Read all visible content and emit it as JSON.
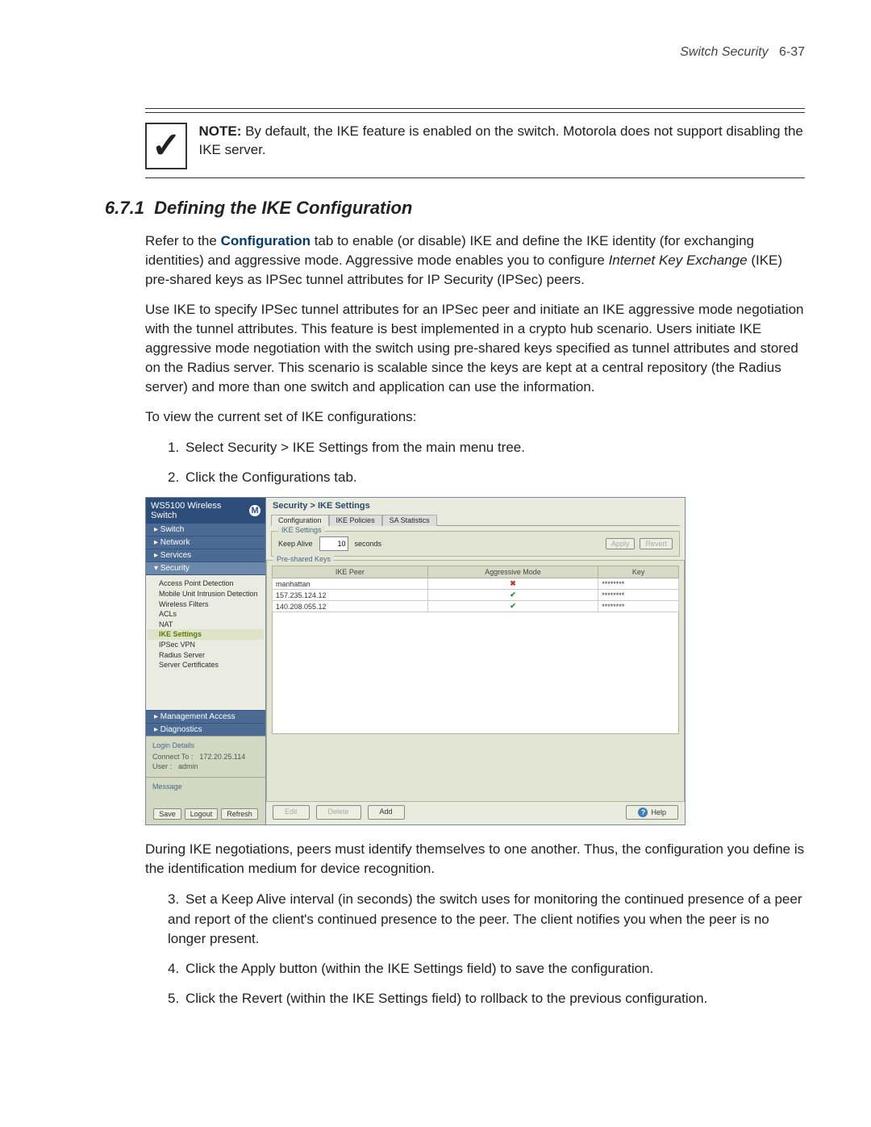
{
  "header": {
    "section": "Switch Security",
    "page": "6-37"
  },
  "note": {
    "label": "NOTE:",
    "text": "By default, the IKE feature is enabled on the switch. Motorola does not support disabling the IKE server."
  },
  "section": {
    "number": "6.7.1",
    "title": "Defining the IKE Configuration"
  },
  "para1_pre": "Refer to the ",
  "para1_bold": "Configuration",
  "para1_mid": " tab to enable (or disable) IKE and define the IKE identity (for exchanging identities) and aggressive mode. Aggressive mode enables you to configure ",
  "para1_italic": "Internet Key Exchange",
  "para1_end": " (IKE) pre-shared keys as IPSec tunnel attributes for IP Security (IPSec) peers.",
  "para2": "Use IKE to specify IPSec tunnel attributes for an IPSec peer and initiate an IKE aggressive mode negotiation with the tunnel attributes. This feature is best implemented in a crypto hub scenario. Users initiate IKE aggressive mode negotiation with the switch using pre-shared keys specified as tunnel attributes and stored on the Radius server. This scenario is scalable since the keys are kept at a central repository (the Radius server) and more than one switch and application can use the information.",
  "para3": "To view the current set of IKE configurations:",
  "step1_pre": "Select ",
  "step1_b1": "Security",
  "step1_gt": " > ",
  "step1_b2": "IKE Settings",
  "step1_end": " from the main menu tree.",
  "step2_pre": "Click the ",
  "step2_b": "Configurations",
  "step2_end": " tab.",
  "para4": "During IKE negotiations, peers must identify themselves to one another. Thus, the configuration you define is the identification medium for device recognition.",
  "step3_pre": "Set a ",
  "step3_b": "Keep Alive",
  "step3_end": " interval (in seconds) the switch uses for monitoring the continued presence of a peer and report of the client's continued presence to the peer. The client notifies you when the peer is no longer present.",
  "step4_pre": "Click the ",
  "step4_b": "Apply",
  "step4_end": " button (within the IKE Settings field) to save the configuration.",
  "step5_pre": "Click the ",
  "step5_b": "Revert",
  "step5_end": " (within the IKE Settings field) to rollback to the previous configuration.",
  "ui": {
    "title": "WS5100 Wireless Switch",
    "nav": {
      "switch": "▸ Switch",
      "network": "▸ Network",
      "services": "▸ Services",
      "security": "▾ Security",
      "ma": "▸ Management Access",
      "diag": "▸ Diagnostics"
    },
    "tree": {
      "apd": "Access Point Detection",
      "muid": "Mobile Unit Intrusion Detection",
      "wf": "Wireless Filters",
      "acl": "ACLs",
      "nat": "NAT",
      "ike": "IKE Settings",
      "ipsec": "IPSec VPN",
      "radius": "Radius Server",
      "cert": "Server Certificates"
    },
    "login": {
      "label": "Login Details",
      "connect_lbl": "Connect To :",
      "connect_val": "172.20.25.114",
      "user_lbl": "User :",
      "user_val": "admin"
    },
    "message_label": "Message",
    "bottom_btns": {
      "save": "Save",
      "logout": "Logout",
      "refresh": "Refresh"
    },
    "breadcrumb": "Security > IKE Settings",
    "tabs": {
      "t1": "Configuration",
      "t2": "IKE Policies",
      "t3": "SA Statistics"
    },
    "panel1_title": "IKE Settings",
    "keep_alive_label": "Keep Alive",
    "keep_alive_value": "10",
    "seconds": "seconds",
    "apply": "Apply",
    "revert": "Revert",
    "panel2_title": "Pre-shared Keys",
    "cols": {
      "c1": "IKE Peer",
      "c2": "Aggressive Mode",
      "c3": "Key"
    },
    "rows": [
      {
        "peer": "manhattan",
        "agg": "x",
        "key": "********"
      },
      {
        "peer": "157.235.124.12",
        "agg": "v",
        "key": "********"
      },
      {
        "peer": "140.208.055.12",
        "agg": "v",
        "key": "********"
      }
    ],
    "footer_btns": {
      "edit": "Edit",
      "delete": "Delete",
      "add": "Add",
      "help": "Help"
    }
  }
}
